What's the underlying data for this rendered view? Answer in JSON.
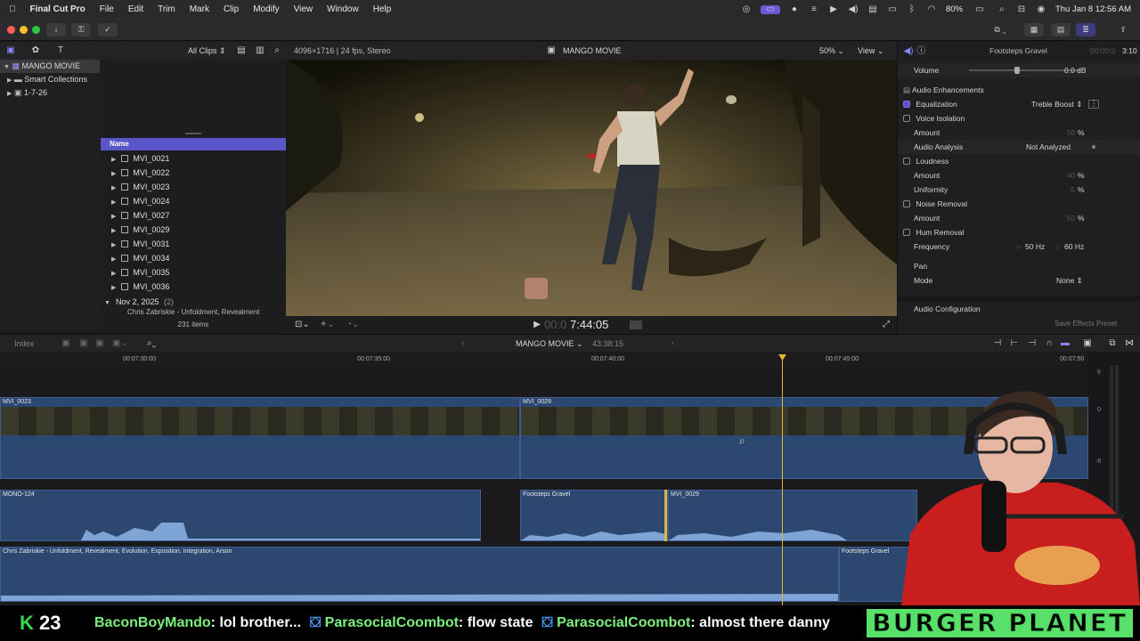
{
  "menubar": {
    "app_name": "Final Cut Pro",
    "items": [
      "File",
      "Edit",
      "Trim",
      "Mark",
      "Clip",
      "Modify",
      "View",
      "Window",
      "Help"
    ],
    "battery": "80%",
    "datetime": "Thu Jan 8  12:56 AM"
  },
  "browser": {
    "filter": "All Clips ⇕",
    "library": "MANGO MOVIE",
    "smart_collections": "Smart Collections",
    "event": "1-7-26",
    "column_name": "Name",
    "clips": [
      "MVI_0021",
      "MVI_0022",
      "MVI_0023",
      "MVI_0024",
      "MVI_0027",
      "MVI_0029",
      "MVI_0031",
      "MVI_0034",
      "MVI_0035",
      "MVI_0036"
    ],
    "date_group": "Nov 2, 2025",
    "date_group_count": "(2)",
    "partial_row": "Chris Zabriskie - Unfoldment, Revealment",
    "item_count": "231 items"
  },
  "viewer": {
    "format": "4096×1716 | 24 fps, Stereo",
    "title": "MANGO MOVIE",
    "zoom": "50% ⌄",
    "view_menu": "View ⌄",
    "timecode_dim": "00:0",
    "timecode": "7:44:05"
  },
  "inspector": {
    "clip_name": "Footsteps Gravel",
    "duration_dim": "00:00:0",
    "duration": "3:10",
    "volume_label": "Volume",
    "volume_value": "0.0 dB",
    "audio_enhancements": "Audio Enhancements",
    "equalization": "Equalization",
    "equalization_value": "Treble Boost ⇕",
    "voice_isolation": "Voice Isolation",
    "amount_label": "Amount",
    "vi_amount": "50",
    "percent": "%",
    "audio_analysis": "Audio Analysis",
    "audio_analysis_value": "Not Analyzed",
    "loudness": "Loudness",
    "loudness_amount": "40",
    "uniformity": "Uniformity",
    "uniformity_value": "5",
    "noise_removal": "Noise Removal",
    "nr_amount": "50",
    "hum_removal": "Hum Removal",
    "frequency": "Frequency",
    "freq_50": "50 Hz",
    "freq_60": "60 Hz",
    "pan": "Pan",
    "mode": "Mode",
    "mode_value": "None ⇕",
    "audio_configuration": "Audio Configuration",
    "save_preset": "Save Effects Preset"
  },
  "timeline": {
    "index": "Index",
    "project": "MANGO MOVIE ⌄",
    "project_duration": "43:38:15",
    "ruler_labels": [
      "00:07:30:00",
      "00:07:35:00",
      "00:07:40:00",
      "00:07:45:00",
      "00:07:50"
    ],
    "video_clip_1": "MVI_0023",
    "video_clip_2": "MVI_0029",
    "audio_clip_1": "MONO-124",
    "audio_clip_2": "Footsteps Gravel",
    "audio_clip_3": "MVI_0029",
    "music_clip": "Chris Zabriskie - Unfoldment, Revealment, Evolution, Exposition, Integration, Arson",
    "music_clip_2": "Footsteps Gravel",
    "meter_labels": [
      "6",
      "0",
      "-6"
    ]
  },
  "ticker": {
    "kick_count": "23",
    "messages": [
      {
        "user": "BaconBoyMando",
        "text": ": lol brother..."
      },
      {
        "user": "ParasocialCoombot",
        "text": ": flow state"
      },
      {
        "user": "ParasocialCoombot",
        "text": ": almost there danny"
      }
    ],
    "brand": "BURGER PLANET"
  },
  "colors": {
    "accent": "#5a55c9",
    "clip_blue": "#2c4770",
    "playhead": "#e3b53a",
    "kick_green": "#35d94a"
  }
}
